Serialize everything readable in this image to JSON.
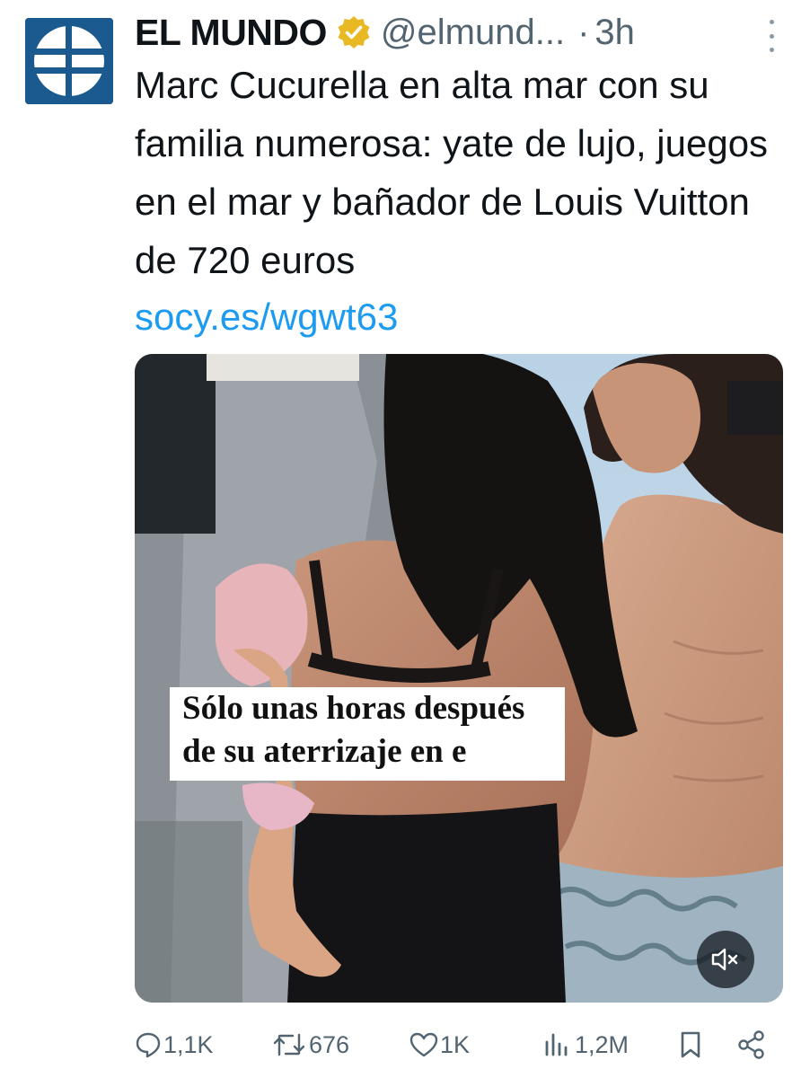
{
  "author": {
    "name": "EL MUNDO",
    "handle": "@elmund...",
    "separator": "·",
    "time": "3h",
    "verified_color": "#e8b923",
    "avatar_color": "#1b5a8e"
  },
  "tweet": {
    "text": "Marc Cucurella en alta mar con su familia numerosa: yate de lujo, juegos en el mar y bañador de Louis Vuitton de 720 euros",
    "link": "socy.es/wgwt63",
    "link_color": "#1d9bf0"
  },
  "media": {
    "caption_line1": "Sólo unas horas después",
    "caption_line2": "de su aterrizaje en e",
    "mute_icon": "speaker-muted-icon"
  },
  "actions": {
    "replies": "1,1K",
    "reposts": "676",
    "likes": "1K",
    "views": "1,2M",
    "bookmark_icon": "bookmark-icon",
    "share_icon": "share-icon"
  }
}
